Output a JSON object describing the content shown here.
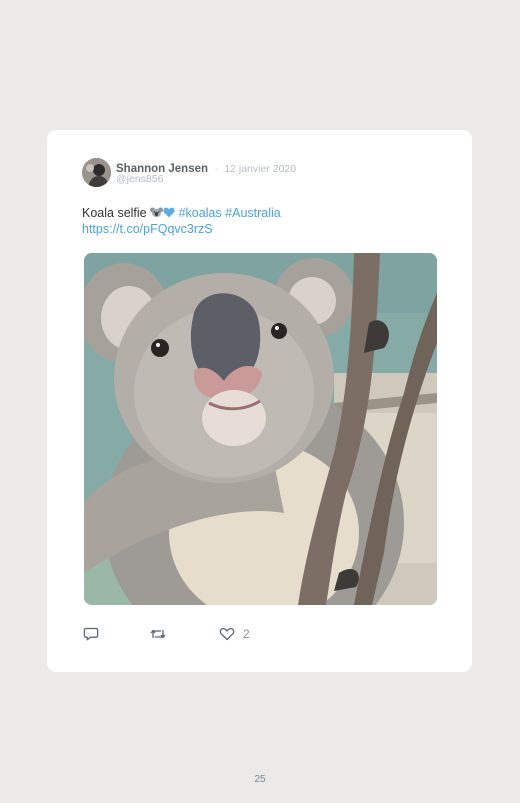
{
  "tweet": {
    "author_name": "Shannon Jensen",
    "separator": "·",
    "date": "12 janvier 2020",
    "handle": "@jens856",
    "text_plain": "Koala selfie ",
    "emoji": [
      "koala-emoji",
      "blue-heart-emoji"
    ],
    "hashtags": [
      "#koalas",
      "#Australia"
    ],
    "link": "https://t.co/pFQqvc3rzS",
    "like_count": "2"
  },
  "icons": {
    "reply": "reply-icon",
    "retweet": "retweet-icon",
    "like": "heart-icon"
  },
  "colors": {
    "link": "#4aa3df",
    "background": "#ebeae8",
    "card": "#ffffff"
  },
  "page": {
    "number": "25"
  }
}
